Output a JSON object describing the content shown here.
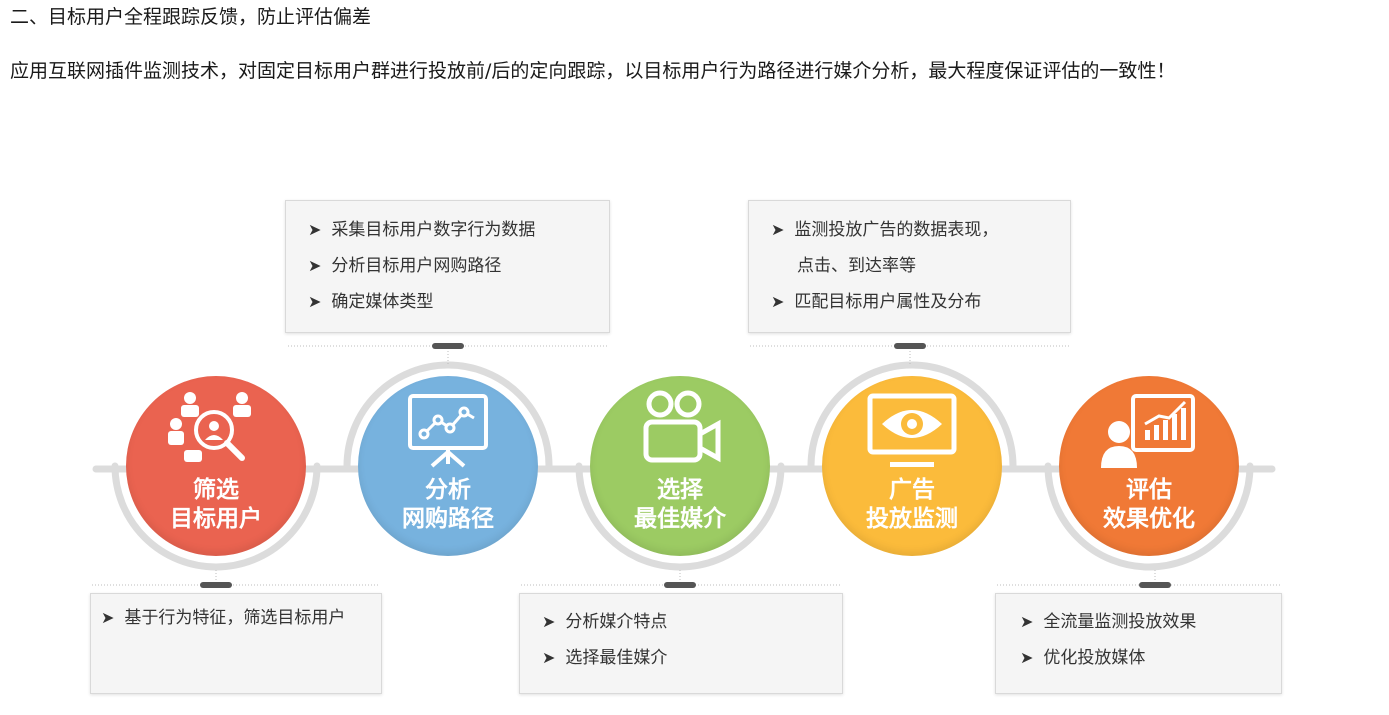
{
  "heading": "二、目标用户全程跟踪反馈，防止评估偏差",
  "description": "应用互联网插件监测技术，对固定目标用户群进行投放前/后的定向跟踪，以目标用户行为路径进行媒介分析，最大程度保证评估的一致性！",
  "bullet_symbol": "➤",
  "colors": {
    "red": "#ea6350",
    "blue": "#77b2de",
    "green": "#9ccb63",
    "yellow": "#fbbb3b",
    "orange": "#f07936",
    "track": "#dcdcdc"
  },
  "steps": [
    {
      "line1": "筛选",
      "line2": "目标用户",
      "icon": "users-search-icon"
    },
    {
      "line1": "分析",
      "line2": "网购路径",
      "icon": "line-chart-board-icon"
    },
    {
      "line1": "选择",
      "line2": "最佳媒介",
      "icon": "video-camera-icon"
    },
    {
      "line1": "广告",
      "line2": "投放监测",
      "icon": "eye-monitor-icon"
    },
    {
      "line1": "评估",
      "line2": "效果优化",
      "icon": "person-bar-chart-icon"
    }
  ],
  "boxes": {
    "top1": [
      "采集目标用户数字行为数据",
      "分析目标用户网购路径",
      "确定媒体类型"
    ],
    "top2": {
      "item1_line1": "监测投放广告的数据表现，",
      "item1_line2": "点击、到达率等",
      "item2": "匹配目标用户属性及分布"
    },
    "bot1": [
      "基于行为特征，筛选目标用户"
    ],
    "bot2": [
      "分析媒介特点",
      "选择最佳媒介"
    ],
    "bot3": [
      "全流量监测投放效果",
      "优化投放媒体"
    ]
  }
}
